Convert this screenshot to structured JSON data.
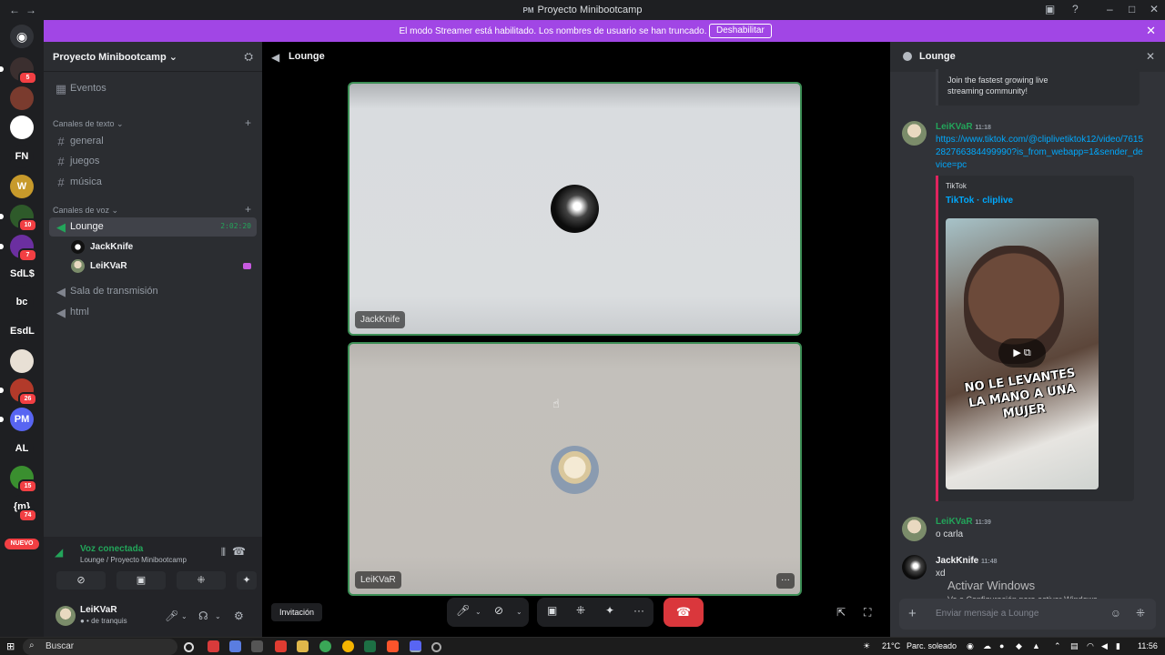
{
  "titlebar": {
    "title": "Proyecto Minibootcamp",
    "logo_text": "PM",
    "back": "←",
    "forward": "→"
  },
  "banner": {
    "message": "El modo Streamer está habilitado. Los nombres de usuario se han truncado.",
    "button": "Deshabilitar",
    "close": "✕"
  },
  "rail": {
    "servers": [
      {
        "label": "",
        "badge": "5",
        "color": "#3b2f2f"
      },
      {
        "label": "",
        "badge": "",
        "color": "#7a3b2e"
      },
      {
        "label": "",
        "badge": "",
        "color": "#ffffff"
      },
      {
        "label": "FN",
        "badge": "",
        "color": "#1e1f22"
      },
      {
        "label": "W",
        "badge": "",
        "color": "#c79a2b"
      },
      {
        "label": "",
        "badge": "10",
        "color": "#2e5a2a"
      },
      {
        "label": "",
        "badge": "7",
        "color": "#6b2fa0"
      },
      {
        "label": "SdL$",
        "badge": "",
        "color": "#1e1f22"
      },
      {
        "label": "bc",
        "badge": "",
        "color": "#1e1f22"
      },
      {
        "label": "EsdL",
        "badge": "",
        "color": "#1e1f22"
      },
      {
        "label": "",
        "badge": "",
        "color": "#e8e0d5"
      },
      {
        "label": "",
        "badge": "26",
        "color": "#b23a2a"
      },
      {
        "label": "PM",
        "badge": "",
        "color": "#5865f2"
      },
      {
        "label": "AL",
        "badge": "",
        "color": "#1e1f22"
      },
      {
        "label": "",
        "badge": "15",
        "color": "#3a8f2f"
      },
      {
        "label": "{m}",
        "badge": "74",
        "color": "#1e1f22"
      }
    ],
    "new_label": "NUEVO"
  },
  "sidebar": {
    "server_name": "Proyecto Minibootcamp",
    "events": "Eventos",
    "text_category": "Canales de texto",
    "text_channels": [
      "general",
      "juegos",
      "música"
    ],
    "voice_category": "Canales de voz",
    "voice_channels": [
      {
        "name": "Lounge",
        "timer": "2:02:20"
      },
      {
        "name": "Sala de transmisión"
      },
      {
        "name": "html"
      }
    ],
    "members": [
      "JackKnife",
      "LeiKVaR"
    ]
  },
  "voice_panel": {
    "status": "Voz conectada",
    "location": "Lounge / Proyecto Minibootcamp"
  },
  "user_panel": {
    "username": "LeiKVaR",
    "status": "de tranquis"
  },
  "main": {
    "channel": "Lounge",
    "tiles": [
      "JackKnife",
      "LeiKVaR"
    ],
    "invite": "Invitación"
  },
  "chat": {
    "title": "Lounge",
    "embed_top_desc": "Join the fastest growing live streaming community!",
    "messages": [
      {
        "author": "LeiKVaR",
        "time": "11:18",
        "text": "https://www.tiktok.com/@cliplivetiktok12/video/7615282766384499990?is_from_webapp=1&sender_device=pc"
      },
      {
        "author": "LeiKVaR",
        "time": "11:39",
        "text": "o carla"
      },
      {
        "author": "JackKnife",
        "time": "11:48",
        "text": "xd"
      }
    ],
    "embed": {
      "provider": "TikTok",
      "title": "TikTok · cliplive",
      "caption": "NO LE LEVANTES LA MANO A UNA MUJER"
    },
    "input_placeholder": "Enviar mensaje a Lounge",
    "name_colors": {
      "LeiKVaR": "#23a55a",
      "JackKnife": "#f2f3f5"
    }
  },
  "watermark": {
    "line1": "Activar Windows",
    "line2": "Ve a Configuración para activar Windows."
  },
  "taskbar": {
    "search": "Buscar",
    "weather": "21°C",
    "weather_desc": "Parc. soleado",
    "time": "11:56"
  }
}
